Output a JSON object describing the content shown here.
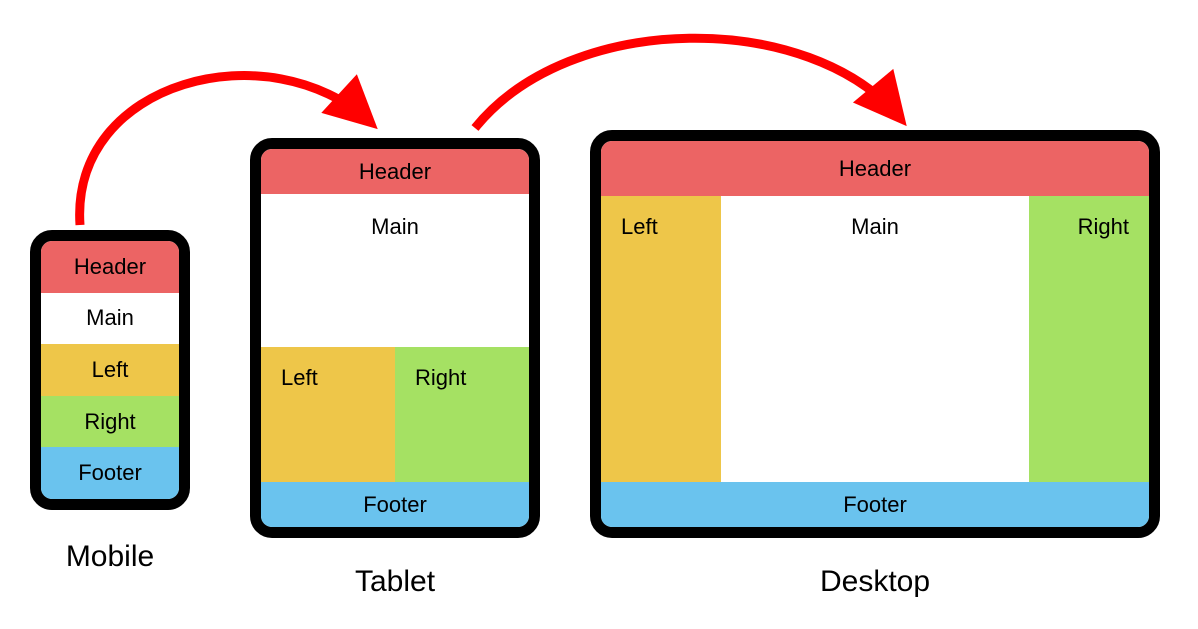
{
  "labels": {
    "header": "Header",
    "main": "Main",
    "left": "Left",
    "right": "Right",
    "footer": "Footer"
  },
  "captions": {
    "mobile": "Mobile",
    "tablet": "Tablet",
    "desktop": "Desktop"
  },
  "colors": {
    "header": "#ec6464",
    "main": "#ffffff",
    "left": "#eec649",
    "right": "#a5e163",
    "footer": "#6ac3ee",
    "arrow": "#ff0000",
    "frame": "#000000"
  }
}
